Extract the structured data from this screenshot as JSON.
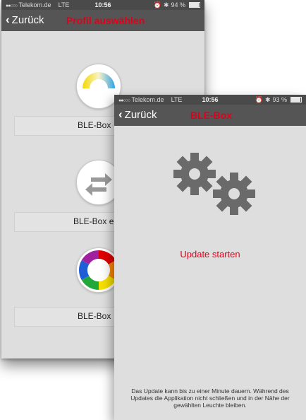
{
  "back_screen": {
    "status": {
      "carrier": "Telekom.de",
      "network": "LTE",
      "time": "10:56",
      "battery": "94 %",
      "battery_level": 0.94
    },
    "nav": {
      "back_label": "Zurück",
      "title": "Profil auswählen"
    },
    "profiles": [
      {
        "label": "BLE-Box",
        "icon": "white-tone-icon"
      },
      {
        "label": "BLE-Box e",
        "icon": "exchange-arrows-icon"
      },
      {
        "label": "BLE-Box",
        "icon": "color-wheel-icon"
      }
    ]
  },
  "front_screen": {
    "status": {
      "carrier": "Telekom.de",
      "network": "LTE",
      "time": "10:56",
      "battery": "93 %",
      "battery_level": 0.93
    },
    "nav": {
      "back_label": "Zurück",
      "title": "BLE-Box"
    },
    "update_label": "Update starten",
    "footnote": "Das Update kann bis zu einer Minute dauern. Während des Updates die Applikation nicht schließen und in der Nähe der gewählten Leuchte bleiben.",
    "icon": "gears-icon"
  },
  "colors": {
    "accent": "#e1001a",
    "navbar": "#555555",
    "statusbar": "#4a4a4a",
    "background": "#dedede"
  }
}
